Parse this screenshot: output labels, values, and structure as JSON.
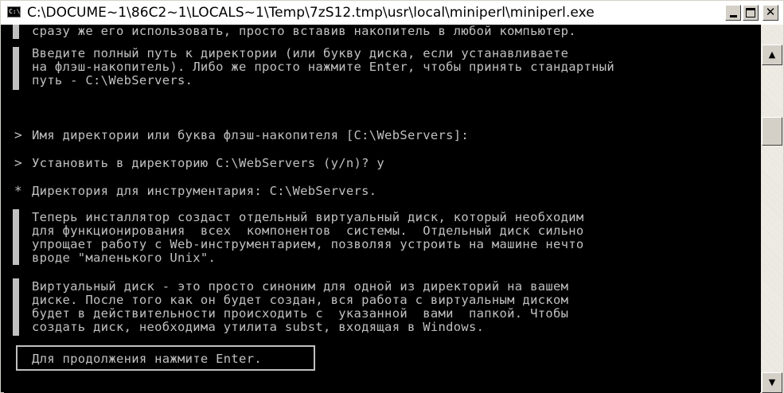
{
  "window": {
    "title": "C:\\DOCUME~1\\86C2~1\\LOCALS~1\\Temp\\7zS12.tmp\\usr\\local\\miniperl\\miniperl.exe",
    "icon_text": "C:\\",
    "controls": {
      "minimize": "minimize-icon",
      "maximize": "maximize-icon",
      "close": "✕"
    }
  },
  "console": {
    "block1": [
      "сразу же его использовать, просто вставив накопитель в любой компьютер."
    ],
    "block2": [
      "Введите полный путь к директории (или букву диска, если устанавливаете",
      "на флэш-накопитель). Либо же просто нажмите Enter, чтобы принять стандартный",
      "путь - C:\\WebServers."
    ],
    "prompt_dir": {
      "marker": ">",
      "text": "Имя директории или буква флэш-накопителя [C:\\WebServers]:"
    },
    "prompt_install": {
      "marker": ">",
      "text": "Установить в директорию C:\\WebServers (y/n)? y"
    },
    "info_dir": {
      "marker": "*",
      "text": "Директория для инструментария: C:\\WebServers."
    },
    "block3": [
      "Теперь инсталлятор создаст отдельный виртуальный диск, который необходим",
      "для функционирования  всех  компонентов  системы.  Отдельный диск сильно",
      "упрощает работу с Web-инструментарием, позволяя устроить на машине нечто",
      "вроде \"маленького Unix\"."
    ],
    "block4": [
      "Виртуальный диск - это просто синоним для одной из директорий на вашем",
      "диске. После того как он будет создан, вся работа с виртуальным диском",
      "будет в действительности происходить с  указанной  вами  папкой. Чтобы",
      "создать диск, необходима утилита subst, входящая в Windows."
    ],
    "continue_prompt": "Для продолжения нажмите Enter."
  },
  "scrollbar": {
    "up_arrow": "▲",
    "down_arrow": "▼"
  }
}
